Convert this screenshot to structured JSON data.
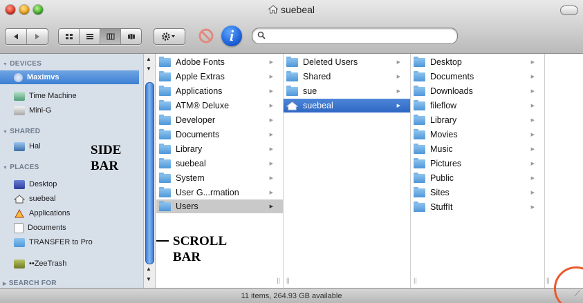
{
  "window": {
    "title": "suebeal",
    "status": "11 items, 264.93 GB available"
  },
  "sidebar": {
    "devices_header": "DEVICES",
    "devices": [
      "Maximvs",
      "Time Machine",
      "Mini-G"
    ],
    "shared_header": "SHARED",
    "shared": [
      "Hal"
    ],
    "places_header": "PLACES",
    "places": [
      "Desktop",
      "suebeal",
      "Applications",
      "Documents",
      "TRANSFER to Pro",
      "••ZeeTrash"
    ],
    "search_header": "SEARCH FOR"
  },
  "columns": [
    {
      "items": [
        "Adobe Fonts",
        "Apple Extras",
        "Applications",
        "ATM® Deluxe",
        "Developer",
        "Documents",
        "Library",
        "suebeal",
        "System",
        "User G...rmation",
        "Users"
      ],
      "selected": "Users"
    },
    {
      "items": [
        "Deleted Users",
        "Shared",
        "sue",
        "suebeal"
      ],
      "selected": "suebeal"
    },
    {
      "items": [
        "Desktop",
        "Documents",
        "Downloads",
        "fileflow",
        "Library",
        "Movies",
        "Music",
        "Pictures",
        "Public",
        "Sites",
        "StuffIt"
      ],
      "selected": ""
    }
  ],
  "annotations": {
    "sidebar_line1": "SIDE",
    "sidebar_line2": "BAR",
    "scroll_line1": "SCROLL",
    "scroll_line2": "BAR"
  },
  "colors": {
    "selection_blue": "#3c7fd4",
    "sidebar_bg": "#d7dfe9",
    "highlight_ring": "#ea5a2c"
  }
}
